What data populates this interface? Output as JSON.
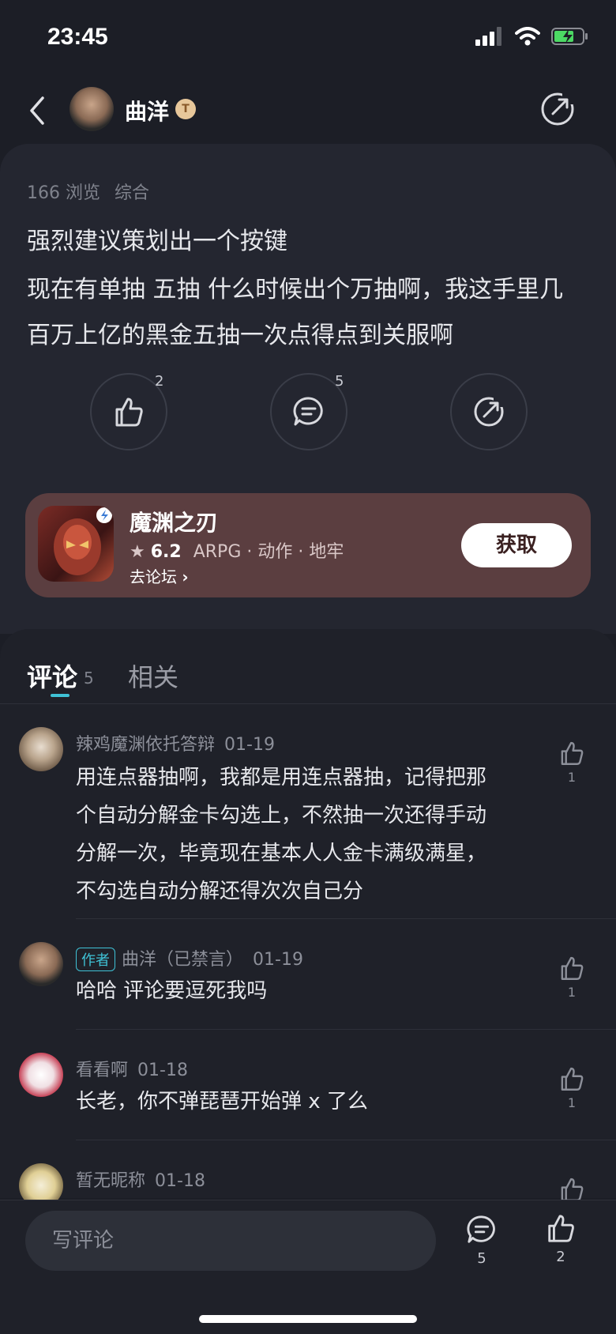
{
  "status": {
    "time": "23:45"
  },
  "header": {
    "author_name": "曲洋",
    "badge": "T"
  },
  "post": {
    "views": "166 浏览",
    "category": "综合",
    "title": "强烈建议策划出一个按键",
    "body_line1": "现在有单抽 五抽 什么时候出个万抽啊，我这手里几",
    "body_line2": "百万上亿的黑金五抽一次点得点到关服啊",
    "like_count": "2",
    "comment_count": "5"
  },
  "game": {
    "name": "魔渊之刃",
    "rating": "6.2",
    "tags": "ARPG · 动作 · 地牢",
    "forum_link": "去论坛",
    "get_button": "获取"
  },
  "tabs": {
    "comments": "评论",
    "comments_count": "5",
    "related": "相关"
  },
  "comments": [
    {
      "name": "辣鸡魔渊依托答辩",
      "date": "01-19",
      "lines": [
        "用连点器抽啊，我都是用连点器抽，记得把那",
        "个自动分解金卡勾选上，不然抽一次还得手动",
        "分解一次，毕竟现在基本人人金卡满级满星，",
        "不勾选自动分解还得次次自己分"
      ],
      "likes": "1"
    },
    {
      "tag": "作者",
      "name": "曲洋（已禁言）",
      "date": "01-19",
      "lines": [
        "哈哈 评论要逗死我吗"
      ],
      "likes": "1"
    },
    {
      "name": "看看啊",
      "date": "01-18",
      "lines": [
        "长老，你不弹琵琶开始弹 x 了么"
      ],
      "likes": "1"
    },
    {
      "name": "暂无昵称",
      "date": "01-18"
    }
  ],
  "bottom": {
    "input_placeholder": "写评论",
    "comment_count": "5",
    "like_count": "2"
  },
  "colors": {
    "background": "#1c1e26",
    "accent": "#3fc2d6",
    "game_card": "#5b3e40"
  },
  "icons": [
    "back-icon",
    "share-icon",
    "like-icon",
    "comment-icon",
    "star-icon",
    "chevron-right-icon"
  ]
}
